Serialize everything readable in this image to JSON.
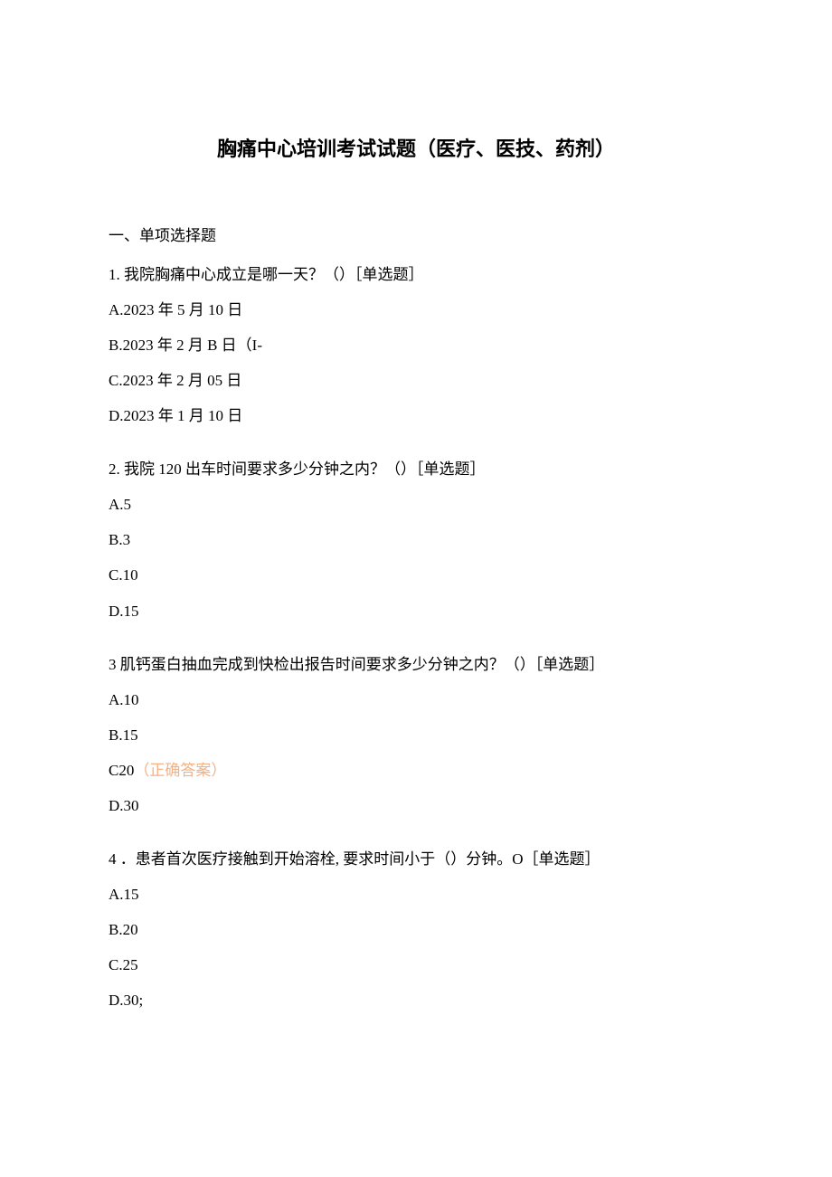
{
  "title": "胸痛中心培训考试试题（医疗、医技、药剂）",
  "section_heading": "一、单项选择题",
  "q1": {
    "stem": "1. 我院胸痛中心成立是哪一天？（）［单选题］",
    "a": "A.2023 年 5 月 10 日",
    "b": "B.2023 年 2 月 B 日（I-",
    "c": "C.2023 年 2 月 05 日",
    "d": "D.2023 年 1 月 10 日"
  },
  "q2": {
    "stem": "2. 我院 120 出车时间要求多少分钟之内？（）［单选题］",
    "a": "A.5",
    "b": "B.3",
    "c": "C.10",
    "d": "D.15"
  },
  "q3": {
    "stem": "3 肌钙蛋白抽血完成到快检出报告时间要求多少分钟之内？（）［单选题］",
    "a": "A.10",
    "b": "B.15",
    "c_pre": "C20",
    "c_ans": "（正确答案）",
    "d": "D.30"
  },
  "q4": {
    "stem": "4 ．患者首次医疗接触到开始溶栓, 要求时间小于（）分钟。O［单选题］",
    "a": "A.15",
    "b": "B.20",
    "c": "C.25",
    "d": "D.30;"
  }
}
